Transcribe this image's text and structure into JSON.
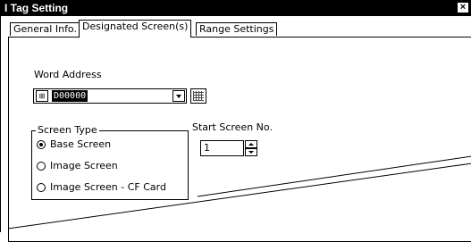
{
  "window": {
    "title": "I Tag Setting",
    "close_glyph": "×"
  },
  "tabs": [
    {
      "label": "General Info."
    },
    {
      "label": "Designated Screen(s)",
      "active": true
    },
    {
      "label": "Range Settings"
    }
  ],
  "word_address": {
    "label": "Word Address",
    "value": "D00000"
  },
  "screen_type": {
    "legend": "Screen Type",
    "options": [
      {
        "label": "Base Screen",
        "selected": true
      },
      {
        "label": "Image Screen",
        "selected": false
      },
      {
        "label": "Image Screen - CF Card",
        "selected": false
      }
    ]
  },
  "start_screen": {
    "label": "Start Screen No.",
    "value": "1"
  }
}
